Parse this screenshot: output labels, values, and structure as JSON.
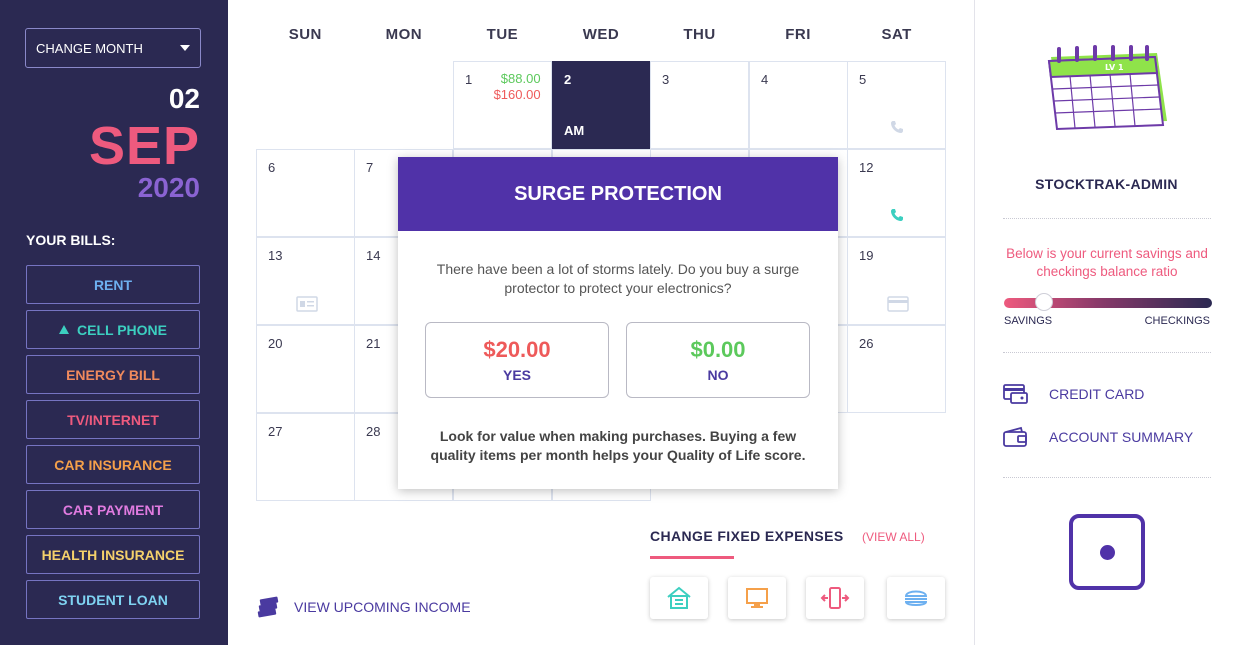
{
  "sidebar": {
    "change_month_label": "CHANGE MONTH",
    "day": "02",
    "month": "SEP",
    "year": "2020",
    "bills_title": "YOUR BILLS:",
    "bills": [
      {
        "label": "RENT",
        "color": "#6db0f0"
      },
      {
        "label": "CELL PHONE",
        "color": "#3ccfc0",
        "warning": true
      },
      {
        "label": "ENERGY BILL",
        "color": "#f08a5d"
      },
      {
        "label": "TV/INTERNET",
        "color": "#ee5a7e"
      },
      {
        "label": "CAR INSURANCE",
        "color": "#f5a04a"
      },
      {
        "label": "CAR PAYMENT",
        "color": "#e07be0"
      },
      {
        "label": "HEALTH INSURANCE",
        "color": "#f5d16b"
      },
      {
        "label": "STUDENT LOAN",
        "color": "#7fd3f2"
      }
    ]
  },
  "calendar": {
    "weekdays": [
      "SUN",
      "MON",
      "TUE",
      "WED",
      "THU",
      "FRI",
      "SAT"
    ],
    "days": [
      {
        "num": "1",
        "income": "$88.00",
        "expense": "$160.00"
      },
      {
        "num": "2",
        "label": "AM"
      },
      {
        "num": "3"
      },
      {
        "num": "4"
      },
      {
        "num": "5",
        "icon": "phone-icon"
      },
      {
        "num": "6"
      },
      {
        "num": "7"
      },
      {
        "num": "12",
        "icon": "phone-icon"
      },
      {
        "num": "13",
        "icon": "id-card-icon"
      },
      {
        "num": "14"
      },
      {
        "num": "19",
        "icon": "credit-card-icon"
      },
      {
        "num": "20"
      },
      {
        "num": "21"
      },
      {
        "num": "26"
      },
      {
        "num": "27"
      },
      {
        "num": "28"
      }
    ]
  },
  "modal": {
    "title": "SURGE PROTECTION",
    "question": "There have been a lot of storms lately. Do you buy a surge protector to protect your electronics?",
    "option_yes": {
      "amount": "$20.00",
      "label": "YES",
      "color": "#ee5a5a"
    },
    "option_no": {
      "amount": "$0.00",
      "label": "NO",
      "color": "#5cc95c"
    },
    "tip": "Look for value when making purchases. Buying a few quality items per month helps your Quality of Life score."
  },
  "bottom": {
    "income_link": "VIEW UPCOMING INCOME",
    "fixed_title": "CHANGE FIXED EXPENSES",
    "view_all": "(VIEW ALL)",
    "fixed_icons": [
      "house-icon",
      "monitor-icon",
      "phone-plan-icon",
      "food-icon"
    ]
  },
  "right": {
    "level_badge": "LV 1",
    "username": "STOCKTRAK-ADMIN",
    "ratio_text": "Below is your current savings and checkings balance ratio",
    "ratio_savings_fraction": 0.19,
    "savings_label": "SAVINGS",
    "checkings_label": "CHECKINGS",
    "credit_card_label": "CREDIT CARD",
    "account_summary_label": "ACCOUNT SUMMARY"
  }
}
